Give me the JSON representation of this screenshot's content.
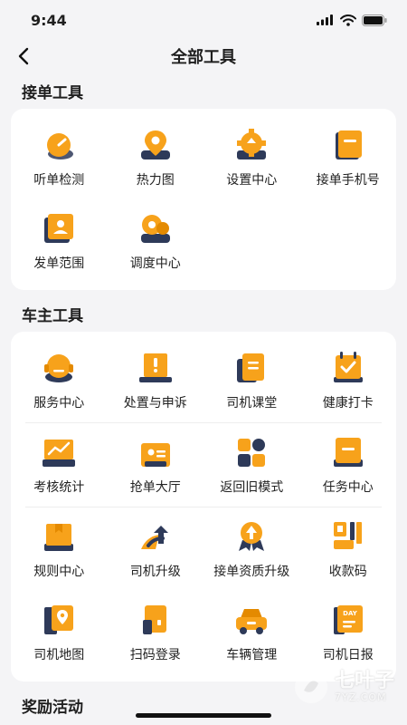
{
  "status": {
    "time": "9:44"
  },
  "header": {
    "title": "全部工具"
  },
  "sections": [
    {
      "title": "接单工具",
      "rows": [
        [
          {
            "label": "听单检测",
            "icon": "gauge-icon"
          },
          {
            "label": "热力图",
            "icon": "map-pin-icon"
          },
          {
            "label": "设置中心",
            "icon": "gear-icon"
          },
          {
            "label": "接单手机号",
            "icon": "phone-card-icon"
          }
        ],
        [
          {
            "label": "发单范围",
            "icon": "range-icon"
          },
          {
            "label": "调度中心",
            "icon": "dispatch-icon"
          }
        ]
      ]
    },
    {
      "title": "车主工具",
      "rows": [
        [
          {
            "label": "服务中心",
            "icon": "headset-icon"
          },
          {
            "label": "处置与申诉",
            "icon": "alert-laptop-icon"
          },
          {
            "label": "司机课堂",
            "icon": "book-icon"
          },
          {
            "label": "健康打卡",
            "icon": "calendar-check-icon"
          }
        ],
        [
          {
            "label": "考核统计",
            "icon": "chart-board-icon"
          },
          {
            "label": "抢单大厅",
            "icon": "hall-icon"
          },
          {
            "label": "返回旧模式",
            "icon": "mode-icon"
          },
          {
            "label": "任务中心",
            "icon": "task-icon"
          }
        ],
        [
          {
            "label": "规则中心",
            "icon": "rule-box-icon"
          },
          {
            "label": "司机升级",
            "icon": "upgrade-icon"
          },
          {
            "label": "接单资质升级",
            "icon": "badge-upgrade-icon"
          },
          {
            "label": "收款码",
            "icon": "qr-icon"
          }
        ],
        [
          {
            "label": "司机地图",
            "icon": "map-icon"
          },
          {
            "label": "扫码登录",
            "icon": "scan-login-icon"
          },
          {
            "label": "车辆管理",
            "icon": "car-icon"
          },
          {
            "label": "司机日报",
            "icon": "daily-report-icon"
          }
        ]
      ]
    },
    {
      "title": "奖励活动",
      "rows": []
    }
  ],
  "watermark": {
    "name": "七叶子",
    "site": "7YZ.COM"
  },
  "colors": {
    "accent": "#F7A21B",
    "accent_dark": "#E48A00",
    "shadow": "#2E3A59"
  }
}
